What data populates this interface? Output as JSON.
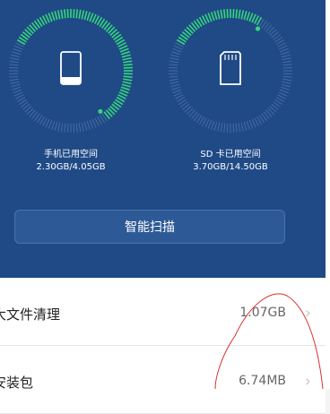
{
  "phone_storage": {
    "label": "手机已用空间",
    "value": "2.30GB/4.05GB",
    "used_fraction": 0.568,
    "icon": "phone-icon"
  },
  "sd_storage": {
    "label": "SD 卡已用空间",
    "value": "3.70GB/14.50GB",
    "used_fraction": 0.255,
    "icon": "sd-card-icon"
  },
  "scan_button": {
    "label": "智能扫描"
  },
  "list": {
    "items": [
      {
        "label": "大文件清理",
        "value": "1.07GB"
      },
      {
        "label": "安装包",
        "value": "6.74MB"
      }
    ]
  },
  "colors": {
    "background": "#1f4a86",
    "gauge_used": "#35d67a",
    "gauge_track": "#6f8fbd",
    "annotation": "#d8302c"
  }
}
